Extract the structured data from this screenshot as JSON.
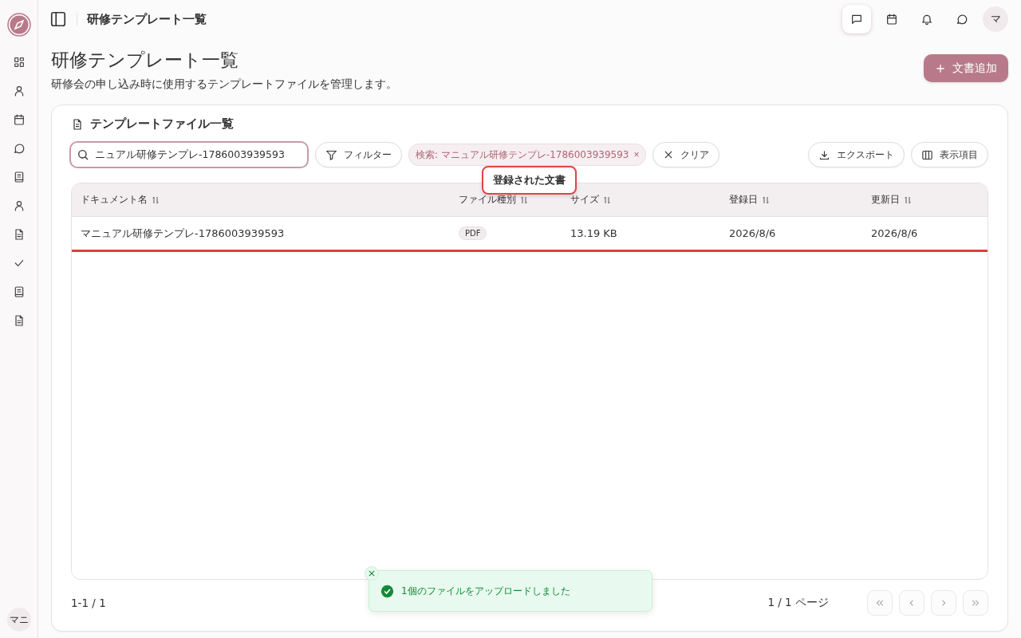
{
  "sidebar": {
    "user_avatar": "マニ"
  },
  "header": {
    "title": "研修テンプレート一覧",
    "icons": [
      {
        "selected": true
      },
      {
        "selected": false
      },
      {
        "selected": false
      },
      {
        "selected": false
      }
    ],
    "avatar": "マ"
  },
  "page": {
    "title": "研修テンプレート一覧",
    "subtitle": "研修会の申し込み時に使用するテンプレートファイルを管理します。",
    "add_button": "文書追加"
  },
  "card": {
    "title": "テンプレートファイル一覧",
    "search": {
      "value": "ニュアル研修テンプレ-1786003939593"
    },
    "filter_button": "フィルター",
    "chip": {
      "label": "検索: マニュアル研修テンプレ-1786003939593",
      "close": "×"
    },
    "clear_button": "クリア",
    "export_button": "エクスポート",
    "columns_button": "表示項目",
    "table": {
      "columns": [
        {
          "label": "ドキュメント名"
        },
        {
          "label": "ファイル種別"
        },
        {
          "label": "サイズ"
        },
        {
          "label": "登録日"
        },
        {
          "label": "更新日"
        }
      ],
      "rows": [
        {
          "name": "マニュアル研修テンプレ-1786003939593",
          "type": "PDF",
          "size": "13.19 KB",
          "created": "2026/8/6",
          "updated": "2026/8/6",
          "highlighted": true
        }
      ]
    },
    "tooltip": "登録された文書",
    "range": "1-1 / 1",
    "page_info": "1 / 1 ページ",
    "pager": [
      {
        "disabled": true
      },
      {
        "disabled": true
      },
      {
        "disabled": true
      },
      {
        "disabled": true
      }
    ]
  },
  "toast": {
    "message": "1個のファイルをアップロードしました",
    "kind": "success"
  }
}
